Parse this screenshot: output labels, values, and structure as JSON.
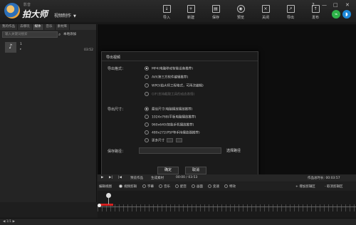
{
  "title_bar": {
    "brand_small": "影音",
    "brand": "拍大师",
    "mode": "视频制作",
    "tools": [
      {
        "label": "导入",
        "icon": "import-icon"
      },
      {
        "label": "新建",
        "icon": "new-icon"
      },
      {
        "label": "保存",
        "icon": "save-icon"
      },
      {
        "label": "预览",
        "icon": "eye-icon"
      },
      {
        "label": "关闭",
        "icon": "close-doc-icon"
      },
      {
        "label": "导出",
        "icon": "export-icon"
      },
      {
        "label": "发布",
        "icon": "upload-icon"
      }
    ],
    "win": {
      "help": "?",
      "minimize": "—",
      "maximize": "□",
      "close": "✕"
    }
  },
  "left_panel": {
    "tabs": [
      "我的作品",
      "去哪玩",
      "媒体",
      "音乐",
      "素材库"
    ],
    "search_placeholder": "输入关键词搜索",
    "add_label": "本地添加",
    "media": {
      "number": "1",
      "sub": "▸",
      "duration": "03:52"
    }
  },
  "export_dialog": {
    "title": "导出视频",
    "format_label": "导出格式：",
    "formats": [
      {
        "label": "MP4(电脑移动智能设备推荐)",
        "selected": true,
        "enabled": true
      },
      {
        "label": "AVI(第三方软件编辑推荐)",
        "selected": false,
        "enabled": true
      },
      {
        "label": "WPO(拍大师工程格式，可再次编辑)",
        "selected": false,
        "enabled": true
      },
      {
        "label": "GIF(支持截取工具的动态表情)",
        "selected": false,
        "enabled": false
      }
    ],
    "size_label": "导出尺寸：",
    "sizes": [
      {
        "label": "最佳尺寸(电脑播放播放推荐)",
        "selected": true
      },
      {
        "label": "1024x768(平板电脑播放推荐)",
        "selected": false
      },
      {
        "label": "960x640(智能手机播放推荐)",
        "selected": false
      },
      {
        "label": "480x272(PSP等手持播放器推荐)",
        "selected": false
      },
      {
        "label": "更多尺寸",
        "selected": false
      }
    ],
    "path_label": "保存路径：",
    "choose_path": "选择路径",
    "ok": "确定",
    "cancel": "取消"
  },
  "playbar": {
    "play": "▶",
    "next": "▶|",
    "step": "|◀",
    "preview_label": "预览作品",
    "gen_label": "生成素材",
    "time": "00:00 / 03:53",
    "total": "作品总时长: 00:03:57"
  },
  "edit_row": {
    "view_label": "编辑视图",
    "modes": [
      {
        "label": "视频剪辑",
        "selected": true
      },
      {
        "label": "字幕",
        "selected": false
      },
      {
        "label": "音乐",
        "selected": false
      },
      {
        "label": "配音",
        "selected": false
      },
      {
        "label": "画面",
        "selected": false
      },
      {
        "label": "变速",
        "selected": false
      },
      {
        "label": "特效",
        "selected": false
      }
    ],
    "add_clip": "+ 增加剪辑区",
    "cancel_clip": "- 取消剪辑区"
  },
  "status_bar": {
    "left": "◀ 1/1 ▶"
  },
  "colors": {
    "accent_red": "#d62020",
    "upload_green": "#2fb34a",
    "upload_blue": "#1e88d8"
  }
}
